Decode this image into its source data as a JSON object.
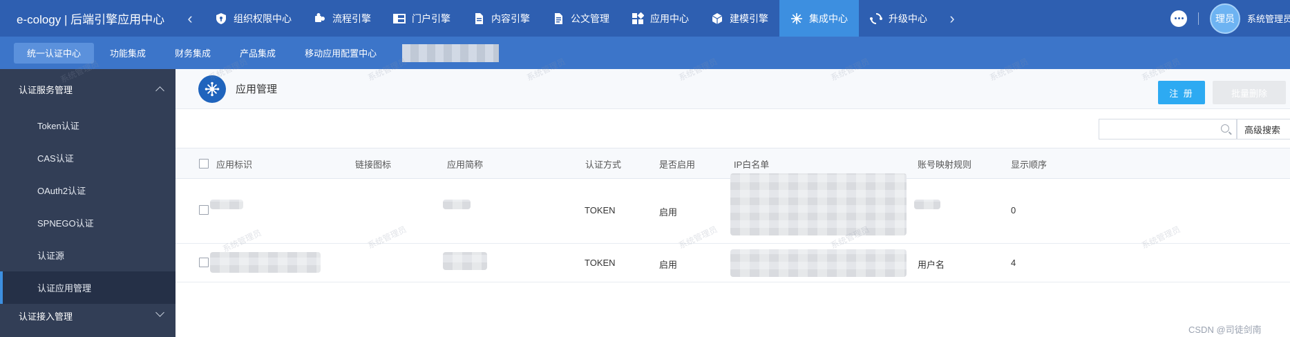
{
  "topbar": {
    "brand": "e-cology | 后端引擎应用中心",
    "nav": [
      {
        "label": "组织权限中心",
        "icon": "shield-icon"
      },
      {
        "label": "流程引擎",
        "icon": "puzzle-icon"
      },
      {
        "label": "门户引擎",
        "icon": "layout-icon"
      },
      {
        "label": "内容引擎",
        "icon": "document-icon"
      },
      {
        "label": "公文管理",
        "icon": "file-list-icon"
      },
      {
        "label": "应用中心",
        "icon": "apps-icon"
      },
      {
        "label": "建模引擎",
        "icon": "cube-icon"
      },
      {
        "label": "集成中心",
        "icon": "hub-icon"
      },
      {
        "label": "升级中心",
        "icon": "sync-icon"
      }
    ],
    "user_avatar": "理员",
    "user_name": "系统管理员"
  },
  "subnav": [
    "统一认证中心",
    "功能集成",
    "财务集成",
    "产品集成",
    "移动应用配置中心"
  ],
  "sidebar": {
    "group1": "认证服务管理",
    "items": [
      "Token认证",
      "CAS认证",
      "OAuth2认证",
      "SPNEGO认证",
      "认证源",
      "认证应用管理"
    ],
    "group2": "认证接入管理"
  },
  "main": {
    "title": "应用管理",
    "register_label": "注 册",
    "batch_delete_label": "批量删除",
    "search_placeholder": "",
    "advanced_search_label": "高级搜索",
    "columns": [
      "应用标识",
      "链接图标",
      "应用简称",
      "认证方式",
      "是否启用",
      "IP白名单",
      "账号映射规则",
      "显示顺序"
    ],
    "rows": [
      {
        "auth": "TOKEN",
        "enabled": "启用",
        "mapping": "",
        "order": "0"
      },
      {
        "auth": "TOKEN",
        "enabled": "启用",
        "mapping": "用户名",
        "order": "4"
      }
    ]
  },
  "watermark_text": "系统管理员",
  "footer_credit": "CSDN @司徒剑南",
  "colors": {
    "topbar": "#2e5fb1",
    "subnav": "#3c75c9",
    "active_tab": "#3d8fe0",
    "sidebar": "#323e56",
    "primary_button": "#2daaf2"
  }
}
